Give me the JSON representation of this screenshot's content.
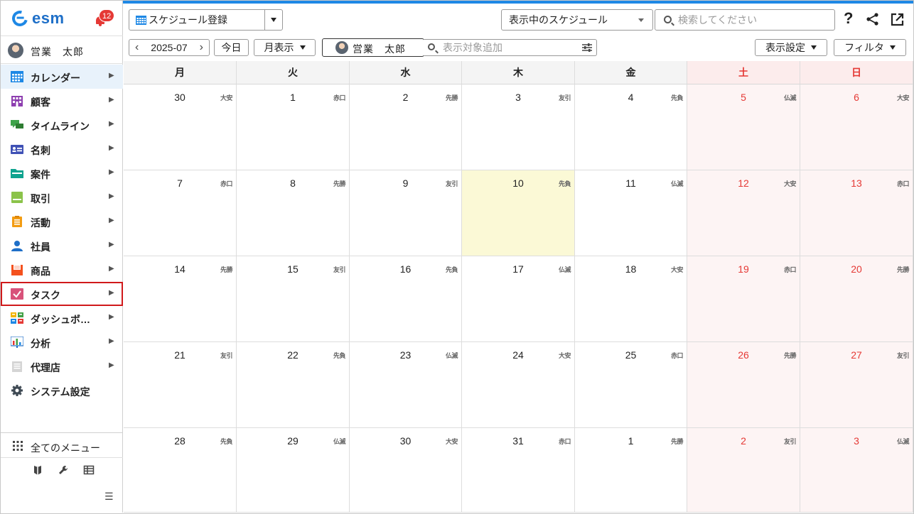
{
  "app": {
    "logo_text": "esm",
    "notification_count": "12"
  },
  "user": {
    "name": "営業　太郎"
  },
  "sidebar": {
    "items": [
      {
        "label": "カレンダー",
        "icon": "calendar-icon",
        "active": true
      },
      {
        "label": "顧客",
        "icon": "building-icon"
      },
      {
        "label": "タイムライン",
        "icon": "chat-icon"
      },
      {
        "label": "名刺",
        "icon": "card-icon"
      },
      {
        "label": "案件",
        "icon": "folder-icon"
      },
      {
        "label": "取引",
        "icon": "deal-icon"
      },
      {
        "label": "活動",
        "icon": "notepad-icon"
      },
      {
        "label": "社員",
        "icon": "person-icon"
      },
      {
        "label": "商品",
        "icon": "product-icon"
      },
      {
        "label": "タスク",
        "icon": "task-check-icon",
        "highlighted": true
      },
      {
        "label": "ダッシュボ…",
        "icon": "dashboard-icon"
      },
      {
        "label": "分析",
        "icon": "chart-icon"
      },
      {
        "label": "代理店",
        "icon": "document-icon"
      },
      {
        "label": "システム設定",
        "icon": "gear-icon"
      }
    ],
    "all_menu_label": "全てのメニュー"
  },
  "toolbar": {
    "schedule_register_label": "スケジュール登録",
    "display_select_value": "表示中のスケジュール",
    "search_placeholder": "検索してください",
    "help_label": "?"
  },
  "subbar": {
    "month": "2025-07",
    "prev_label": "‹",
    "next_label": "›",
    "today_label": "今日",
    "view_label": "月表示",
    "member_name": "営業　太郎",
    "target_placeholder": "表示対象追加",
    "display_settings_label": "表示設定",
    "filter_label": "フィルタ"
  },
  "calendar": {
    "weekdays": [
      "月",
      "火",
      "水",
      "木",
      "金",
      "土",
      "日"
    ],
    "weeks": [
      [
        [
          "30",
          "大安"
        ],
        [
          "1",
          "赤口"
        ],
        [
          "2",
          "先勝"
        ],
        [
          "3",
          "友引"
        ],
        [
          "4",
          "先負"
        ],
        [
          "5",
          "仏滅"
        ],
        [
          "6",
          "大安"
        ]
      ],
      [
        [
          "7",
          "赤口"
        ],
        [
          "8",
          "先勝"
        ],
        [
          "9",
          "友引"
        ],
        [
          "10",
          "先負"
        ],
        [
          "11",
          "仏滅"
        ],
        [
          "12",
          "大安"
        ],
        [
          "13",
          "赤口"
        ]
      ],
      [
        [
          "14",
          "先勝"
        ],
        [
          "15",
          "友引"
        ],
        [
          "16",
          "先負"
        ],
        [
          "17",
          "仏滅"
        ],
        [
          "18",
          "大安"
        ],
        [
          "19",
          "赤口"
        ],
        [
          "20",
          "先勝"
        ]
      ],
      [
        [
          "21",
          "友引"
        ],
        [
          "22",
          "先負"
        ],
        [
          "23",
          "仏滅"
        ],
        [
          "24",
          "大安"
        ],
        [
          "25",
          "赤口"
        ],
        [
          "26",
          "先勝"
        ],
        [
          "27",
          "友引"
        ]
      ],
      [
        [
          "28",
          "先負"
        ],
        [
          "29",
          "仏滅"
        ],
        [
          "30",
          "大安"
        ],
        [
          "31",
          "赤口"
        ],
        [
          "1",
          "先勝"
        ],
        [
          "2",
          "友引"
        ],
        [
          "3",
          "仏滅"
        ]
      ]
    ],
    "today_cell": [
      1,
      3
    ],
    "colors": {
      "weekend_text": "#e53935",
      "today_bg": "#fbf9d6",
      "accent": "#1e88e5"
    }
  }
}
